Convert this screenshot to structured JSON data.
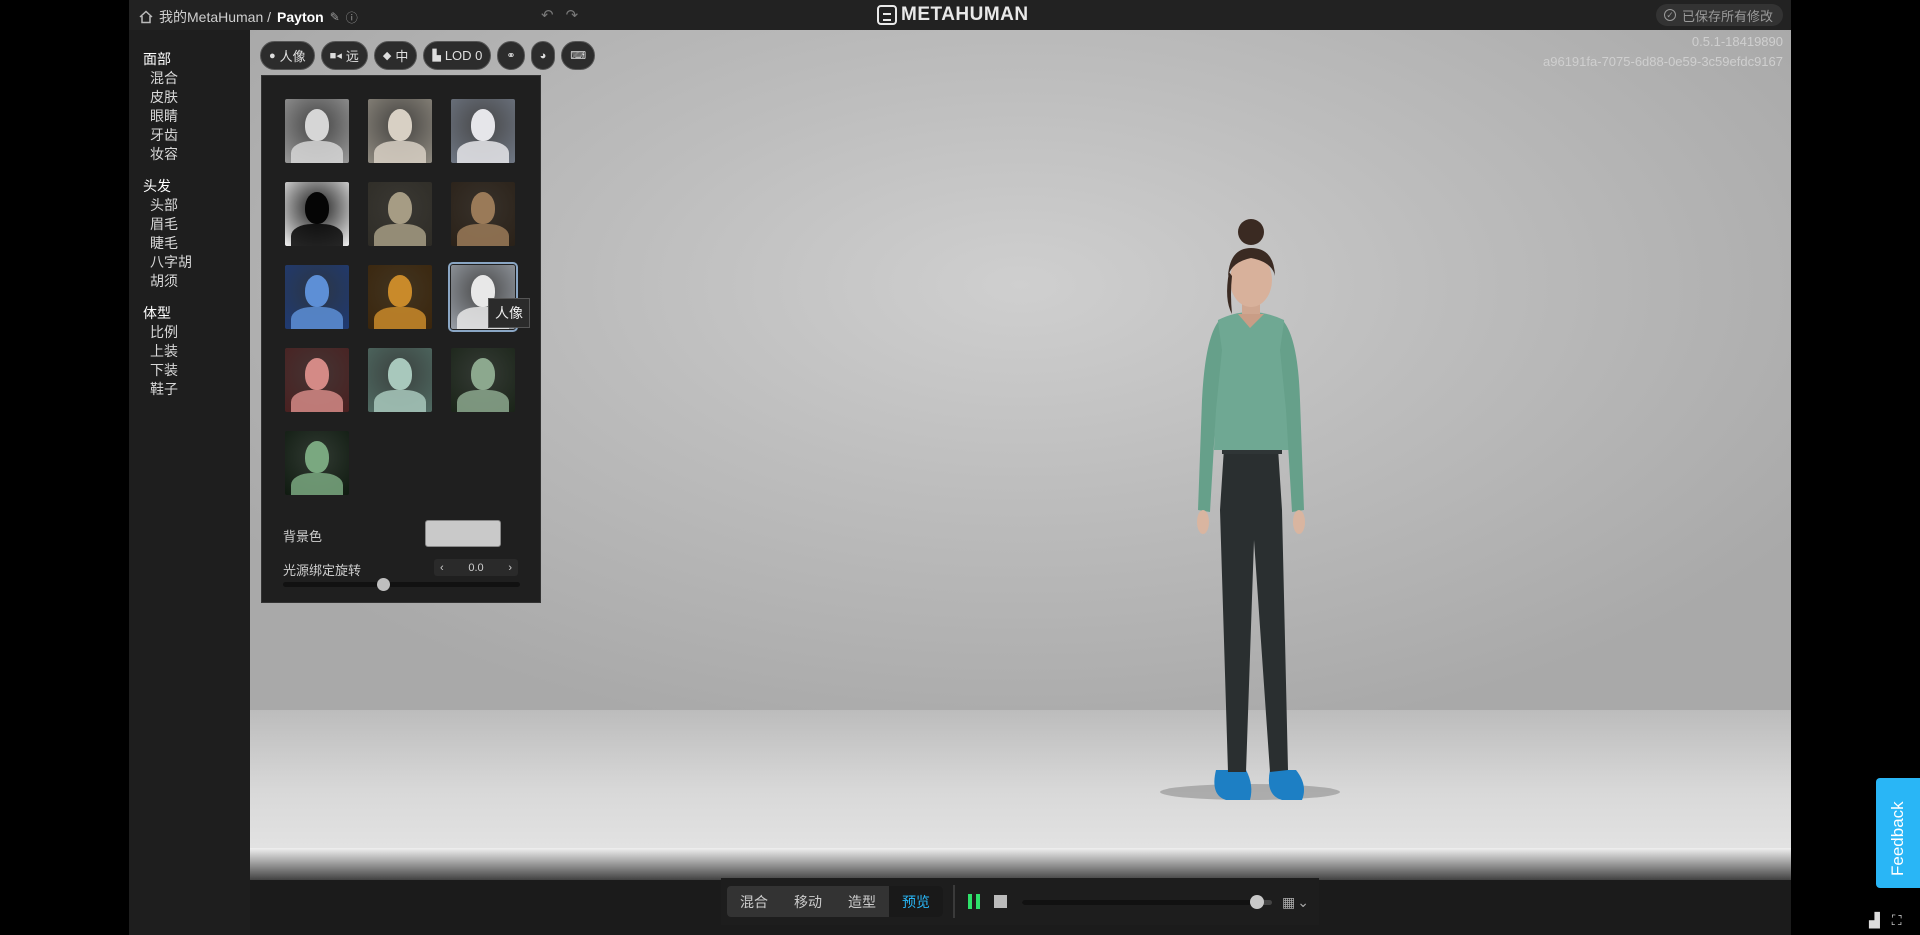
{
  "topbar": {
    "breadcrumb_root": "我的MetaHuman /",
    "character_name": "Payton",
    "logo_text": "METAHUMAN",
    "save_status": "已保存所有修改"
  },
  "nav": {
    "sections": [
      {
        "title": "面部",
        "items": [
          "混合",
          "皮肤",
          "眼睛",
          "牙齿",
          "妆容"
        ]
      },
      {
        "title": "头发",
        "items": [
          "头部",
          "眉毛",
          "睫毛",
          "八字胡",
          "胡须"
        ]
      },
      {
        "title": "体型",
        "items": [
          "比例",
          "上装",
          "下装",
          "鞋子"
        ]
      }
    ]
  },
  "viewport": {
    "version": "0.5.1-18419890",
    "guid": "a96191fa-7075-6d88-0e59-3c59efdc9167",
    "toolbar": {
      "lighting_label": "人像",
      "camera_label": "远",
      "quality_label": "中",
      "lod_label": "LOD 0"
    }
  },
  "light_panel": {
    "tooltip": "人像",
    "background_color_label": "背景色",
    "background_color": "#c9c9c9",
    "rotation_label": "光源绑定旋转",
    "rotation_value": "0.0",
    "rotation_slider_fraction": 0.42,
    "presets": [
      {
        "bg": "#9a9a9a",
        "face": "#d6d6d6"
      },
      {
        "bg": "#8f8a80",
        "face": "#d8d0c4"
      },
      {
        "bg": "#6f7784",
        "face": "#e6e6ea"
      },
      {
        "bg": "#f2f2f2",
        "face": "#050505"
      },
      {
        "bg": "#2e2c26",
        "face": "#a69c84"
      },
      {
        "bg": "#2a2118",
        "face": "#9a7a58"
      },
      {
        "bg": "#1f3a74",
        "face": "#5d8fd6"
      },
      {
        "bg": "#3a250c",
        "face": "#c98a2a"
      },
      {
        "bg": "#9aa0a8",
        "face": "#e8e8e8",
        "selected": true
      },
      {
        "bg": "#4a2020",
        "face": "#d48a86"
      },
      {
        "bg": "#4f6a62",
        "face": "#a8c8bc"
      },
      {
        "bg": "#1a2418",
        "face": "#8ca88e"
      },
      {
        "bg": "#0f1a10",
        "face": "#7aa880"
      }
    ]
  },
  "bottombar": {
    "tabs": [
      {
        "label": "混合",
        "active": false
      },
      {
        "label": "移动",
        "active": false
      },
      {
        "label": "造型",
        "active": false
      },
      {
        "label": "预览",
        "active": true
      }
    ],
    "progress_fraction": 0.94
  },
  "feedback_label": "Feedback",
  "colors": {
    "accent": "#29b6f6",
    "play_green": "#2ee06a"
  }
}
